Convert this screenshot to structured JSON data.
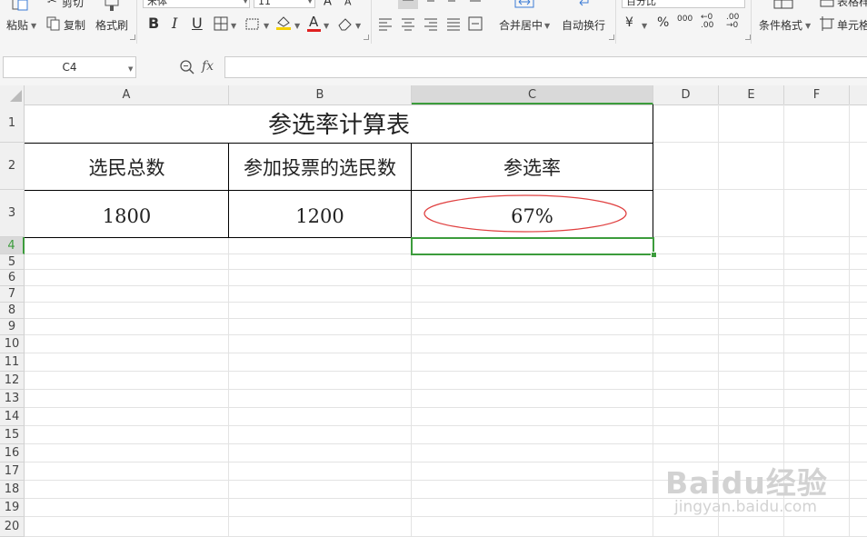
{
  "ribbon": {
    "paste_label": "粘贴",
    "cut_label": "剪切",
    "copy_label": "复制",
    "format_painter_label": "格式刷",
    "font_name": "宋体",
    "font_size": "11",
    "bold": "B",
    "italic": "I",
    "underline": "U",
    "font_color_letter": "A",
    "merge_center_label": "合并居中",
    "wrap_text_label": "自动换行",
    "number_format": "百分比",
    "currency_symbol": "¥",
    "percent_symbol": "%",
    "thousands_symbol": "000",
    "conditional_format_label": "条件格式",
    "table_style_label": "表格样式",
    "cell_style_label": "单元格"
  },
  "formula_bar": {
    "name_box": "C4",
    "fx_label": "fx",
    "formula": ""
  },
  "columns": [
    "A",
    "B",
    "C",
    "D",
    "E",
    "F"
  ],
  "rows": [
    "1",
    "2",
    "3",
    "4",
    "5",
    "6",
    "7",
    "8",
    "9",
    "10",
    "11",
    "12",
    "13",
    "14",
    "15",
    "16",
    "17",
    "18",
    "19",
    "20"
  ],
  "sheet": {
    "title": "参选率计算表",
    "header_a": "选民总数",
    "header_b": "参加投票的选民数",
    "header_c": "参选率",
    "value_a": "1800",
    "value_b": "1200",
    "value_c": "67%"
  },
  "watermark": {
    "brand": "Baidu经验",
    "url": "jingyan.baidu.com"
  },
  "colors": {
    "selection": "#3c9c3c",
    "annotation": "#e04040"
  }
}
